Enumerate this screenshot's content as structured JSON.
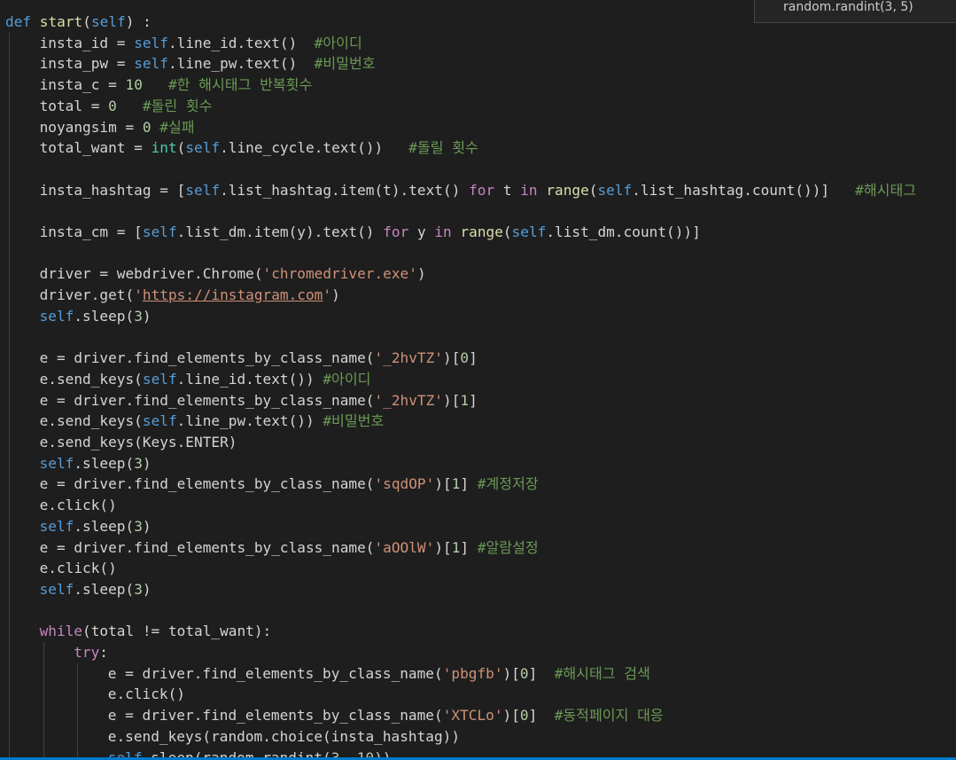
{
  "tooltip": "random.randint(3, 5)",
  "lines": [
    {
      "indent": 0,
      "tokens": [
        {
          "t": "def",
          "c": "kw"
        },
        {
          "t": " "
        },
        {
          "t": "start",
          "c": "fn"
        },
        {
          "t": "("
        },
        {
          "t": "self",
          "c": "self"
        },
        {
          "t": ") :"
        }
      ]
    },
    {
      "indent": 1,
      "tokens": [
        {
          "t": "insta_id = "
        },
        {
          "t": "self",
          "c": "self"
        },
        {
          "t": ".line_id.text()  "
        },
        {
          "t": "#아이디",
          "c": "cm"
        }
      ]
    },
    {
      "indent": 1,
      "tokens": [
        {
          "t": "insta_pw = "
        },
        {
          "t": "self",
          "c": "self"
        },
        {
          "t": ".line_pw.text()  "
        },
        {
          "t": "#비밀번호",
          "c": "cm"
        }
      ]
    },
    {
      "indent": 1,
      "tokens": [
        {
          "t": "insta_c = "
        },
        {
          "t": "10",
          "c": "num"
        },
        {
          "t": "   "
        },
        {
          "t": "#한 해시태그 반복횟수",
          "c": "cm"
        }
      ]
    },
    {
      "indent": 1,
      "tokens": [
        {
          "t": "total = "
        },
        {
          "t": "0",
          "c": "num"
        },
        {
          "t": "   "
        },
        {
          "t": "#돌린 횟수",
          "c": "cm"
        }
      ]
    },
    {
      "indent": 1,
      "tokens": [
        {
          "t": "noyangsim = "
        },
        {
          "t": "0",
          "c": "num"
        },
        {
          "t": " "
        },
        {
          "t": "#실패",
          "c": "cm"
        }
      ]
    },
    {
      "indent": 1,
      "tokens": [
        {
          "t": "total_want = "
        },
        {
          "t": "int",
          "c": "builtin"
        },
        {
          "t": "("
        },
        {
          "t": "self",
          "c": "self"
        },
        {
          "t": ".line_cycle.text())   "
        },
        {
          "t": "#돌릴 횟수",
          "c": "cm"
        }
      ]
    },
    {
      "indent": 0,
      "tokens": []
    },
    {
      "indent": 1,
      "tokens": [
        {
          "t": "insta_hashtag = ["
        },
        {
          "t": "self",
          "c": "self"
        },
        {
          "t": ".list_hashtag.item(t).text() "
        },
        {
          "t": "for",
          "c": "ctl"
        },
        {
          "t": " t "
        },
        {
          "t": "in",
          "c": "ctl"
        },
        {
          "t": " "
        },
        {
          "t": "range",
          "c": "fn"
        },
        {
          "t": "("
        },
        {
          "t": "self",
          "c": "self"
        },
        {
          "t": ".list_hashtag.count())]   "
        },
        {
          "t": "#해시태그",
          "c": "cm"
        }
      ]
    },
    {
      "indent": 0,
      "tokens": []
    },
    {
      "indent": 1,
      "tokens": [
        {
          "t": "insta_cm = ["
        },
        {
          "t": "self",
          "c": "self"
        },
        {
          "t": ".list_dm.item(y).text() "
        },
        {
          "t": "for",
          "c": "ctl"
        },
        {
          "t": " y "
        },
        {
          "t": "in",
          "c": "ctl"
        },
        {
          "t": " "
        },
        {
          "t": "range",
          "c": "fn"
        },
        {
          "t": "("
        },
        {
          "t": "self",
          "c": "self"
        },
        {
          "t": ".list_dm.count())]"
        }
      ]
    },
    {
      "indent": 0,
      "tokens": []
    },
    {
      "indent": 1,
      "tokens": [
        {
          "t": "driver = webdriver.Chrome("
        },
        {
          "t": "'chromedriver.exe'",
          "c": "str"
        },
        {
          "t": ")"
        }
      ]
    },
    {
      "indent": 1,
      "tokens": [
        {
          "t": "driver.get("
        },
        {
          "t": "'",
          "c": "str"
        },
        {
          "t": "https://instagram.com",
          "c": "str url"
        },
        {
          "t": "'",
          "c": "str"
        },
        {
          "t": ")"
        }
      ]
    },
    {
      "indent": 1,
      "tokens": [
        {
          "t": "self",
          "c": "self"
        },
        {
          "t": ".sleep("
        },
        {
          "t": "3",
          "c": "num"
        },
        {
          "t": ")"
        }
      ]
    },
    {
      "indent": 0,
      "tokens": []
    },
    {
      "indent": 1,
      "tokens": [
        {
          "t": "e = driver.find_elements_by_class_name("
        },
        {
          "t": "'_2hvTZ'",
          "c": "str"
        },
        {
          "t": ")["
        },
        {
          "t": "0",
          "c": "num"
        },
        {
          "t": "]"
        }
      ]
    },
    {
      "indent": 1,
      "tokens": [
        {
          "t": "e.send_keys("
        },
        {
          "t": "self",
          "c": "self"
        },
        {
          "t": ".line_id.text()) "
        },
        {
          "t": "#아이디",
          "c": "cm"
        }
      ]
    },
    {
      "indent": 1,
      "tokens": [
        {
          "t": "e = driver.find_elements_by_class_name("
        },
        {
          "t": "'_2hvTZ'",
          "c": "str"
        },
        {
          "t": ")["
        },
        {
          "t": "1",
          "c": "num"
        },
        {
          "t": "]"
        }
      ]
    },
    {
      "indent": 1,
      "tokens": [
        {
          "t": "e.send_keys("
        },
        {
          "t": "self",
          "c": "self"
        },
        {
          "t": ".line_pw.text()) "
        },
        {
          "t": "#비밀번호",
          "c": "cm"
        }
      ]
    },
    {
      "indent": 1,
      "tokens": [
        {
          "t": "e.send_keys(Keys.ENTER)"
        }
      ]
    },
    {
      "indent": 1,
      "tokens": [
        {
          "t": "self",
          "c": "self"
        },
        {
          "t": ".sleep("
        },
        {
          "t": "3",
          "c": "num"
        },
        {
          "t": ")"
        }
      ]
    },
    {
      "indent": 1,
      "tokens": [
        {
          "t": "e = driver.find_elements_by_class_name("
        },
        {
          "t": "'sqdOP'",
          "c": "str"
        },
        {
          "t": ")["
        },
        {
          "t": "1",
          "c": "num"
        },
        {
          "t": "] "
        },
        {
          "t": "#계정저장",
          "c": "cm"
        }
      ]
    },
    {
      "indent": 1,
      "tokens": [
        {
          "t": "e.click()"
        }
      ]
    },
    {
      "indent": 1,
      "tokens": [
        {
          "t": "self",
          "c": "self"
        },
        {
          "t": ".sleep("
        },
        {
          "t": "3",
          "c": "num"
        },
        {
          "t": ")"
        }
      ]
    },
    {
      "indent": 1,
      "tokens": [
        {
          "t": "e = driver.find_elements_by_class_name("
        },
        {
          "t": "'aOOlW'",
          "c": "str"
        },
        {
          "t": ")["
        },
        {
          "t": "1",
          "c": "num"
        },
        {
          "t": "] "
        },
        {
          "t": "#알람설정",
          "c": "cm"
        }
      ]
    },
    {
      "indent": 1,
      "tokens": [
        {
          "t": "e.click()"
        }
      ]
    },
    {
      "indent": 1,
      "tokens": [
        {
          "t": "self",
          "c": "self"
        },
        {
          "t": ".sleep("
        },
        {
          "t": "3",
          "c": "num"
        },
        {
          "t": ")"
        }
      ]
    },
    {
      "indent": 0,
      "tokens": []
    },
    {
      "indent": 1,
      "tokens": [
        {
          "t": "while",
          "c": "ctl"
        },
        {
          "t": "(total != total_want):"
        }
      ]
    },
    {
      "indent": 2,
      "tokens": [
        {
          "t": "try",
          "c": "ctl"
        },
        {
          "t": ":"
        }
      ]
    },
    {
      "indent": 3,
      "tokens": [
        {
          "t": "e = driver.find_elements_by_class_name("
        },
        {
          "t": "'pbgfb'",
          "c": "str"
        },
        {
          "t": ")["
        },
        {
          "t": "0",
          "c": "num"
        },
        {
          "t": "]  "
        },
        {
          "t": "#해시태그 검색",
          "c": "cm"
        }
      ]
    },
    {
      "indent": 3,
      "tokens": [
        {
          "t": "e.click()"
        }
      ]
    },
    {
      "indent": 3,
      "tokens": [
        {
          "t": "e = driver.find_elements_by_class_name("
        },
        {
          "t": "'XTCLo'",
          "c": "str"
        },
        {
          "t": ")["
        },
        {
          "t": "0",
          "c": "num"
        },
        {
          "t": "]  "
        },
        {
          "t": "#동적페이지 대응",
          "c": "cm"
        }
      ]
    },
    {
      "indent": 3,
      "tokens": [
        {
          "t": "e.send_keys(random.choice(insta_hashtag))"
        }
      ]
    },
    {
      "indent": 3,
      "tokens": [
        {
          "t": "self",
          "c": "self"
        },
        {
          "t": ".sleep(random.randint("
        },
        {
          "t": "3",
          "c": "num"
        },
        {
          "t": ", "
        },
        {
          "t": "10",
          "c": "num"
        },
        {
          "t": "))"
        }
      ]
    }
  ]
}
